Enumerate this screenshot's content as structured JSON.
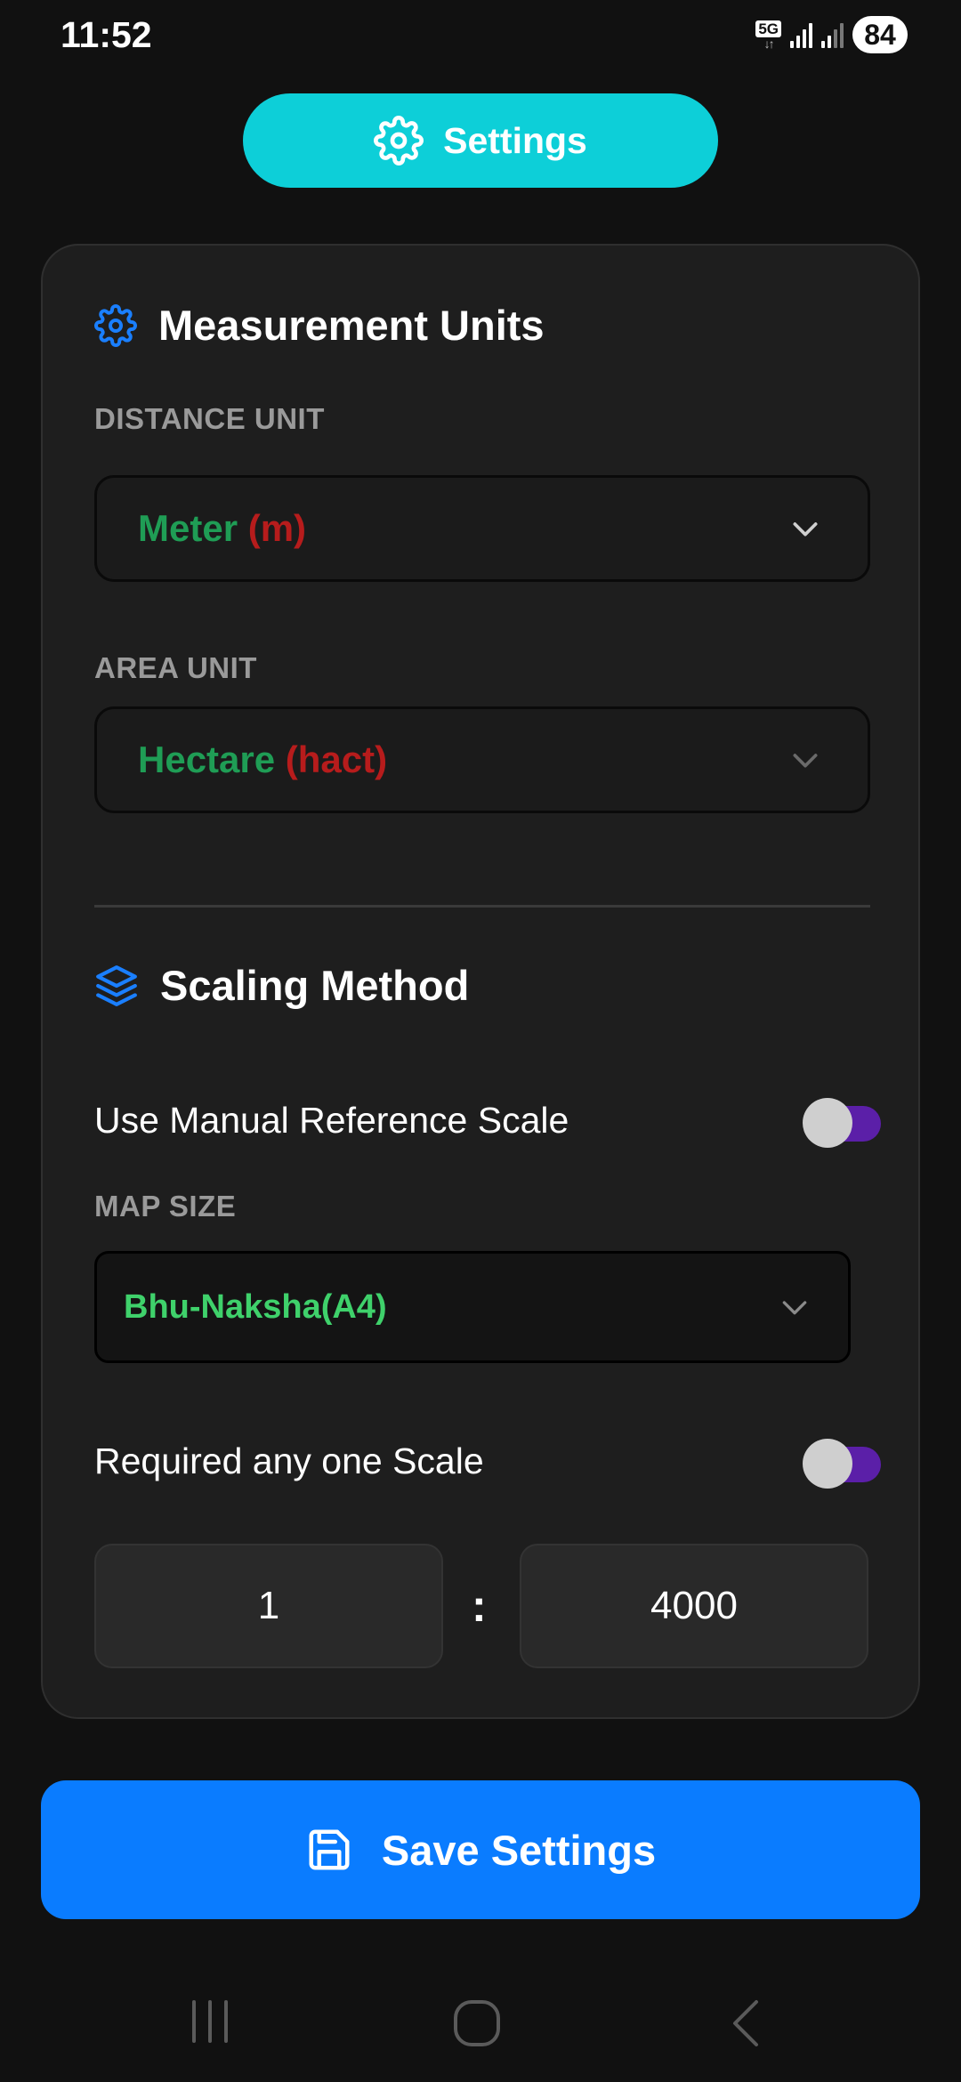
{
  "status_bar": {
    "time": "11:52",
    "network": "5G",
    "network_arrows": "↓↑",
    "battery": "84"
  },
  "header": {
    "title": "Settings",
    "icon": "gear-icon",
    "color": "#0dcfd8"
  },
  "measurement": {
    "title": "Measurement Units",
    "icon": "gear-icon",
    "distance_label": "DISTANCE UNIT",
    "distance_value": "Meter",
    "distance_unit": "(m)",
    "area_label": "AREA UNIT",
    "area_value": "Hectare",
    "area_unit": "(hact)"
  },
  "scaling": {
    "title": "Scaling Method",
    "icon": "layers-icon",
    "manual_scale_label": "Use Manual Reference Scale",
    "manual_scale_on": false,
    "map_size_label": "MAP SIZE",
    "map_size_value": "Bhu-Naksha(A4)",
    "required_scale_label": "Required any one Scale",
    "required_scale_on": false,
    "scale_left": "1",
    "scale_separator": ":",
    "scale_right": "4000"
  },
  "save_button": {
    "label": "Save Settings",
    "icon": "save-icon",
    "color": "#0a7cff"
  },
  "nav_bar": {
    "recents": "recents-icon",
    "home": "home-icon",
    "back": "back-icon"
  }
}
